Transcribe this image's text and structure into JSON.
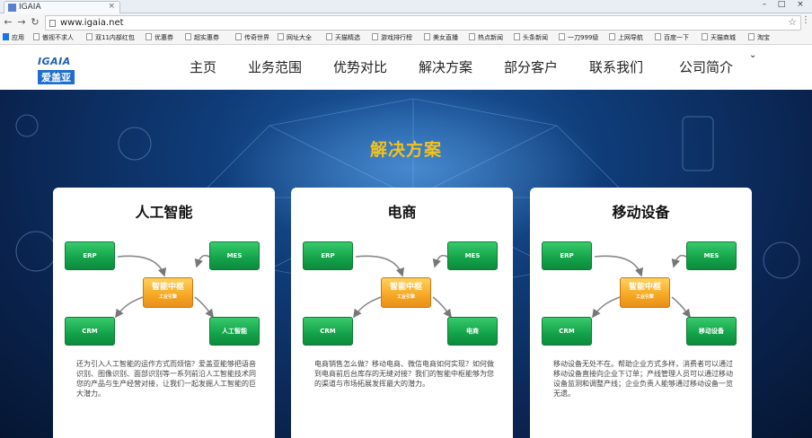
{
  "browser": {
    "tab_title": "IGAIA",
    "url": "www.igaia.net",
    "bookmarks": [
      "应用",
      "傲视不求人",
      "双11内部红包",
      "优惠券",
      "超实惠券",
      "传奇世界",
      "网址大全",
      "天猫精选",
      "游戏排行榜",
      "美女直播",
      "热点新闻",
      "头条新闻",
      "一刀999级",
      "上网导航",
      "百度一下",
      "天猫商城",
      "淘宝"
    ]
  },
  "site": {
    "logo_text": "IGAIA",
    "logo_sub": "爱盖亚",
    "nav": [
      "主页",
      "业务范围",
      "优势对比",
      "解决方案",
      "部分客户",
      "联系我们",
      "公司简介"
    ]
  },
  "hero": {
    "title": "解决方案"
  },
  "cards": [
    {
      "title": "人工智能",
      "boxes": [
        "ERP",
        "MES",
        "CRM",
        "人工智能"
      ],
      "hub": "智能中枢",
      "hub_sub": "工业引擎",
      "text": "还为引入人工智能的运作方式而烦恼？爱盖亚能够把语音识别、图像识别、面部识别等一系列前沿人工智能技术同您的产品与生产经营对接，让我们一起发掘人工智能的巨大潜力。"
    },
    {
      "title": "电商",
      "boxes": [
        "ERP",
        "MES",
        "CRM",
        "电商"
      ],
      "hub": "智能中枢",
      "hub_sub": "工业引擎",
      "text": "电商销售怎么做？移动电商、微信电商如何实现？如何做到电商前后台库存的无缝对接？我们的智能中枢能够为您的渠道与市场拓展发挥最大的潜力。"
    },
    {
      "title": "移动设备",
      "boxes": [
        "ERP",
        "MES",
        "CRM",
        "移动设备"
      ],
      "hub": "智能中枢",
      "hub_sub": "工业引擎",
      "text": "移动设备无处不在。帮助企业方式多样，消费者可以通过移动设备直接向企业下订单；产线管理人员可以通过移动设备监测和调整产线；企业负责人能够通过移动设备一览无遗。"
    }
  ]
}
